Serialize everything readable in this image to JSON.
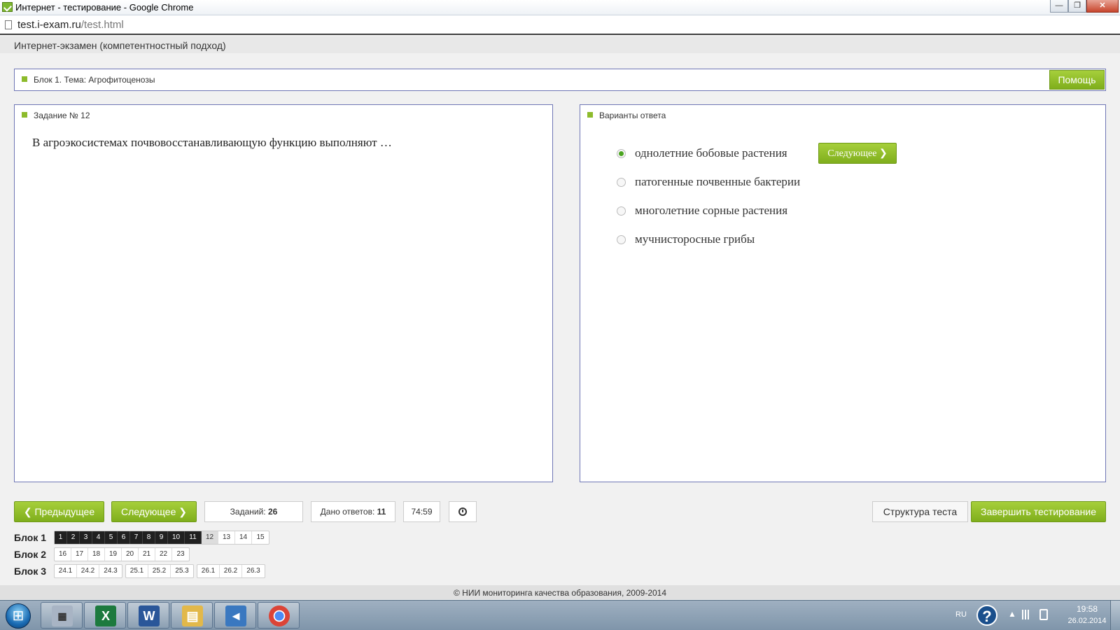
{
  "window": {
    "title": "Интернет - тестирование - Google Chrome",
    "minimize": "—",
    "maximize": "❐",
    "close": "✕"
  },
  "address": {
    "host": "test.i-exam.ru",
    "path": "/test.html"
  },
  "header": {
    "title": "Интернет-экзамен (компетентностный подход)"
  },
  "block": {
    "title": "Блок 1. Тема: Агрофитоценозы",
    "help_label": "Помощь"
  },
  "question": {
    "title": "Задание № 12",
    "text": "В агроэкосистемах почвовосстанавливающую функцию выполняют …"
  },
  "answers": {
    "title": "Варианты ответа",
    "next_label": "Следующее",
    "options": [
      {
        "label": "однолетние бобовые растения",
        "checked": true
      },
      {
        "label": "патогенные почвенные бактерии",
        "checked": false
      },
      {
        "label": "многолетние сорные растения",
        "checked": false
      },
      {
        "label": "мучнисторосные грибы",
        "checked": false
      }
    ]
  },
  "nav": {
    "prev_label": "Предыдущее",
    "next_label": "Следующее",
    "tasks_label": "Заданий:",
    "tasks_count": "26",
    "answered_label": "Дано ответов:",
    "answered_count": "11",
    "timer": "74:59",
    "structure_label": "Структура теста",
    "finish_label": "Завершить тестирование"
  },
  "grid": {
    "blocks": [
      {
        "label": "Блок 1",
        "groups": [
          {
            "cells": [
              "1",
              "2",
              "3",
              "4",
              "5",
              "6",
              "7",
              "8",
              "9",
              "10",
              "11",
              "12",
              "13",
              "14",
              "15"
            ],
            "done": 11,
            "current": "12"
          }
        ]
      },
      {
        "label": "Блок 2",
        "groups": [
          {
            "cells": [
              "16",
              "17",
              "18",
              "19",
              "20",
              "21",
              "22",
              "23"
            ],
            "done": 0,
            "current": ""
          }
        ]
      },
      {
        "label": "Блок 3",
        "groups": [
          {
            "cells": [
              "24.1",
              "24.2",
              "24.3"
            ],
            "done": 0,
            "current": ""
          },
          {
            "cells": [
              "25.1",
              "25.2",
              "25.3"
            ],
            "done": 0,
            "current": ""
          },
          {
            "cells": [
              "26.1",
              "26.2",
              "26.3"
            ],
            "done": 0,
            "current": ""
          }
        ]
      }
    ]
  },
  "footer": {
    "copyright": "© НИИ мониторинга качества образования, 2009-2014"
  },
  "taskbar": {
    "apps": [
      {
        "name": "calculator-icon",
        "glyph": "▦"
      },
      {
        "name": "excel-icon",
        "glyph": "X"
      },
      {
        "name": "word-icon",
        "glyph": "W"
      },
      {
        "name": "explorer-icon",
        "glyph": "▤"
      },
      {
        "name": "media-player-icon",
        "glyph": "◄"
      },
      {
        "name": "chrome-icon",
        "glyph": ""
      }
    ],
    "language": "RU",
    "help_glyph": "?",
    "tray_arrow": "▲",
    "time": "19:58",
    "date": "26.02.2014"
  },
  "colors": {
    "accent_green": "#8dbb2c",
    "panel_border": "#6e76b5",
    "done_cell": "#202020",
    "radio_checked": "#4aa420"
  }
}
